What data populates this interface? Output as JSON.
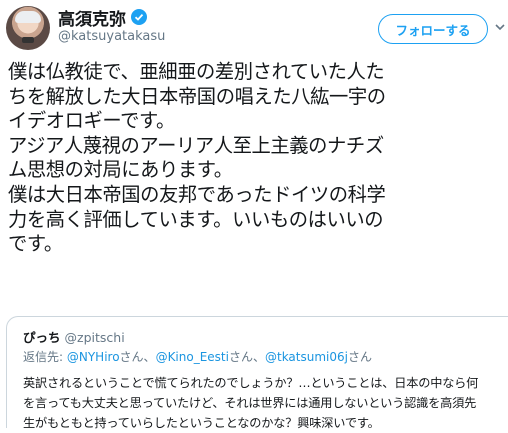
{
  "header": {
    "display_name": "高須克弥",
    "handle": "@katsuyatakasu",
    "follow_label": "フォローする",
    "verified_icon": "verified-badge-icon",
    "menu_icon": "chevron-down-icon"
  },
  "tweet": {
    "lines": [
      "僕は仏教徒で、亜細亜の差別されていた人た",
      "ちを解放した大日本帝国の唱えた八紘一宇の",
      "イデオロギーです。",
      "アジア人蔑視のアーリア人至上主義のナチズ",
      "ム思想の対局にあります。",
      "僕は大日本帝国の友邦であったドイツの科学",
      "力を高く評価しています。いいものはいいの",
      "です。"
    ]
  },
  "quote": {
    "name": "ぴっち",
    "handle": "@zpitschi",
    "reply_prefix": "返信先: ",
    "mention_1": "@NYHiro",
    "suffix_1": "さん、",
    "mention_2": "@Kino_Eesti",
    "suffix_2": "さん、",
    "mention_3": "@tkatsumi06j",
    "suffix_3": "さん",
    "lines": [
      "英訳されるということで慌てられたのでしょうか？…ということは、日本の中なら何",
      "を言っても大丈夫と思っていたけど、それは世界には通用しないという認識を高須先",
      "生がもともと持っていらしたということなのかな？興味深いです。"
    ]
  },
  "colors": {
    "accent": "#1da1f2",
    "secondary_text": "#657786",
    "border": "#ccd6dd"
  }
}
